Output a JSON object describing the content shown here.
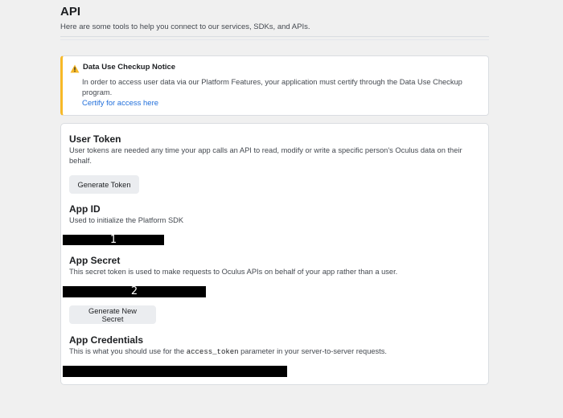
{
  "header": {
    "title": "API",
    "subtitle": "Here are some tools to help you connect to our services, SDKs, and APIs."
  },
  "notice": {
    "icon": "warning-icon",
    "accent_color": "#f7b928",
    "title": "Data Use Checkup Notice",
    "body": "In order to access user data via our Platform Features, your application must certify through the Data Use Checkup program.",
    "link": "Certify for access here"
  },
  "user_token": {
    "title": "User Token",
    "description": "User tokens are needed any time your app calls an API to read, modify or write a specific person's Oculus data on their behalf.",
    "button": "Generate Token"
  },
  "app_id": {
    "title": "App ID",
    "description": "Used to initialize the Platform SDK",
    "redaction_label": "1"
  },
  "app_secret": {
    "title": "App Secret",
    "description": "This secret token is used to make requests to Oculus APIs on behalf of your app rather than a user.",
    "redaction_label": "2",
    "button": "Generate New Secret"
  },
  "app_credentials": {
    "title": "App Credentials",
    "description_before": "This is what you should use for the ",
    "description_code": "access_token",
    "description_after": " parameter in your server-to-server requests."
  }
}
